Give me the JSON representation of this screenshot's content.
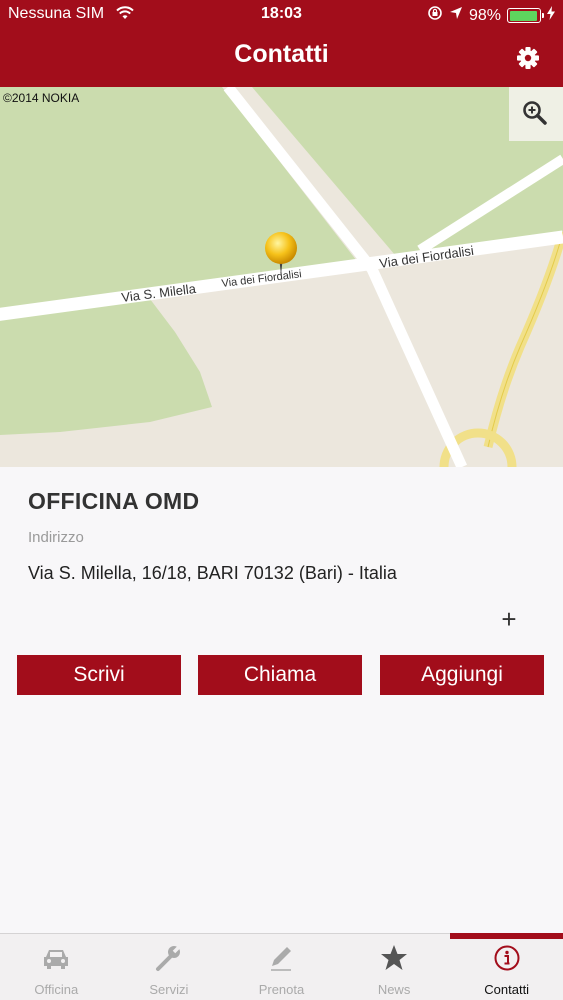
{
  "status": {
    "carrier": "Nessuna SIM",
    "time": "18:03",
    "battery": "98%"
  },
  "header": {
    "title": "Contatti"
  },
  "map": {
    "copyright": "©2014 NOKIA",
    "streets": [
      "Via S. Milella",
      "Via dei Fiordalisi",
      "Via dei Fiordalisi"
    ]
  },
  "contact": {
    "name": "OFFICINA OMD",
    "address_label": "Indirizzo",
    "address": "Via S. Milella, 16/18, BARI 70132 (Bari) - Italia",
    "more": "+"
  },
  "actions": {
    "write": "Scrivi",
    "call": "Chiama",
    "add": "Aggiungi"
  },
  "tabs": [
    {
      "label": "Officina",
      "icon": "car-icon"
    },
    {
      "label": "Servizi",
      "icon": "wrench-icon"
    },
    {
      "label": "Prenota",
      "icon": "pencil-icon"
    },
    {
      "label": "News",
      "icon": "star-icon"
    },
    {
      "label": "Contatti",
      "icon": "info-icon"
    }
  ],
  "colors": {
    "brand": "#a20d1b",
    "battery": "#5ed55e"
  }
}
